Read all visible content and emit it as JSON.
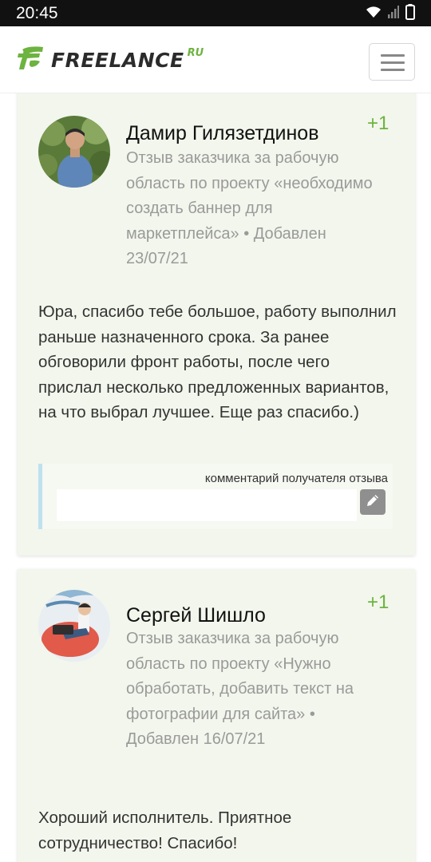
{
  "status_bar": {
    "time": "20:45",
    "icons": [
      "wifi-icon",
      "signal-icon",
      "battery-icon"
    ]
  },
  "header": {
    "logo_text": "FREELANCE",
    "logo_suffix": "RU",
    "brand_color": "#6db33f"
  },
  "reviews": [
    {
      "author": "Дамир Гилязетдинов",
      "score": "+1",
      "meta": "Отзыв заказчика за рабочую область по проекту «необходимо создать баннер для маркетплейса» • Добавлен 23/07/21",
      "text": "Юра, спасибо тебе большое, работу выполнил раньше назначенного срока. За ранее обговорили фронт работы, после чего прислал несколько предложенных вариантов, на что выбрал лучшее. Еще раз спасибо.)",
      "reply_label": "комментарий получателя отзыва",
      "reply_value": ""
    },
    {
      "author": "Сергей Шишло",
      "score": "+1",
      "meta": "Отзыв заказчика за рабочую область по проекту «Нужно обработать, добавить текст на фотографии для сайта» • Добавлен 16/07/21",
      "text": "Хороший исполнитель. Приятное сотрудничество! Спасибо!"
    }
  ],
  "colors": {
    "card_background": "#f2f6ec",
    "reply_border": "#bfe1ef",
    "muted_text": "#9a9a9a"
  }
}
